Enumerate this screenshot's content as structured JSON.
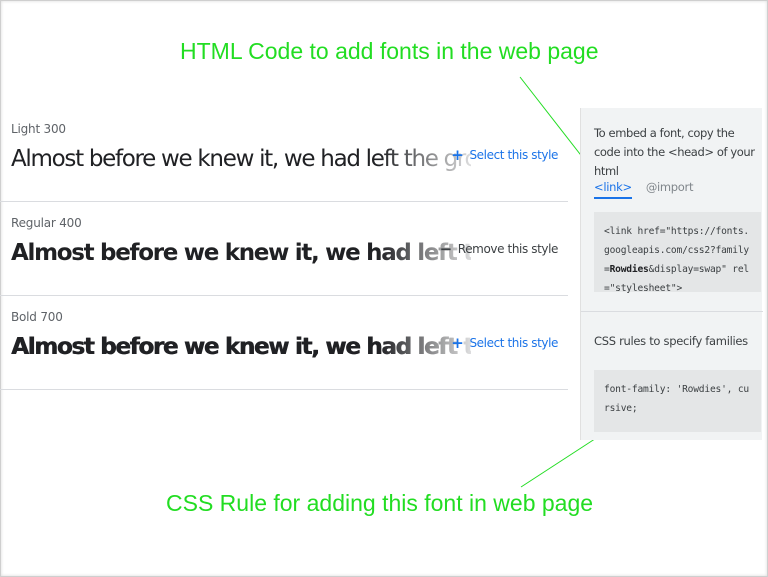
{
  "annotations": {
    "top": "HTML Code to add fonts in the web page",
    "bottom": "CSS Rule for adding this font in web page"
  },
  "styles": [
    {
      "label": "Light 300",
      "sample": "Almost before we knew it, we had left the ground.",
      "action_symbol": "+",
      "action_label": "Select this style"
    },
    {
      "label": "Regular 400",
      "sample": "Almost before we knew it, we had left the ground.",
      "action_symbol": "−",
      "action_label": "Remove this style"
    },
    {
      "label": "Bold 700",
      "sample": "Almost before we knew it, we had left the ground.",
      "action_symbol": "+",
      "action_label": "Select this style"
    }
  ],
  "panel": {
    "intro": "To embed a font, copy the code into the <head> of your html",
    "tabs": [
      "<link>",
      "@import"
    ],
    "link_code": {
      "before": "<link href=\"https://fonts.googleapis.com/css2?family=",
      "bold": "Rowdies",
      "after": "&display=swap\" rel=\"stylesheet\">"
    },
    "css_heading": "CSS rules to specify families",
    "css_code": "font-family: 'Rowdies', cursive;"
  },
  "colors": {
    "annotation": "#22dd22",
    "accent": "#1a73e8",
    "panel_bg": "#f1f3f4",
    "code_bg": "#e4e6e7"
  }
}
